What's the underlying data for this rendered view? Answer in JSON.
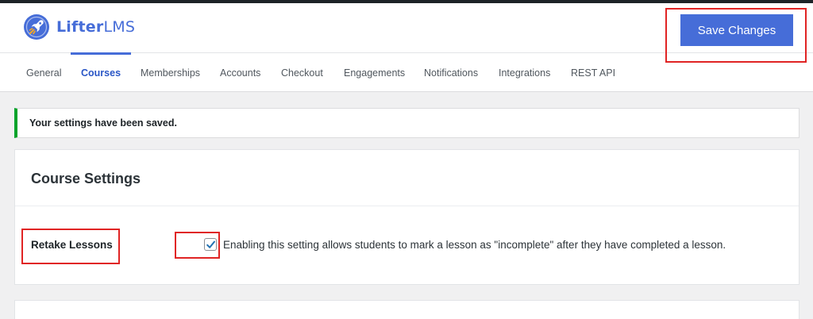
{
  "brand": {
    "name_bold": "Lifter",
    "name_light": "LMS",
    "logo_icon": "rocket-badge-icon",
    "accent_color": "#466dd8"
  },
  "header": {
    "save_label": "Save Changes"
  },
  "tabs": [
    {
      "label": "General",
      "active": false
    },
    {
      "label": "Courses",
      "active": true
    },
    {
      "label": "Memberships",
      "active": false
    },
    {
      "label": "Accounts",
      "active": false
    },
    {
      "label": "Checkout",
      "active": false
    },
    {
      "label": "Engagements",
      "active": false
    },
    {
      "label": "Notifications",
      "active": false
    },
    {
      "label": "Integrations",
      "active": false
    },
    {
      "label": "REST API",
      "active": false
    }
  ],
  "notice": {
    "text": "Your settings have been saved.",
    "status_color": "#00a32a"
  },
  "course_settings": {
    "title": "Course Settings",
    "retake_lessons": {
      "label": "Retake Lessons",
      "checked": true,
      "description": "Enabling this setting allows students to mark a lesson as \"incomplete\" after they have completed a lesson."
    }
  },
  "highlight_color": "#e02424"
}
